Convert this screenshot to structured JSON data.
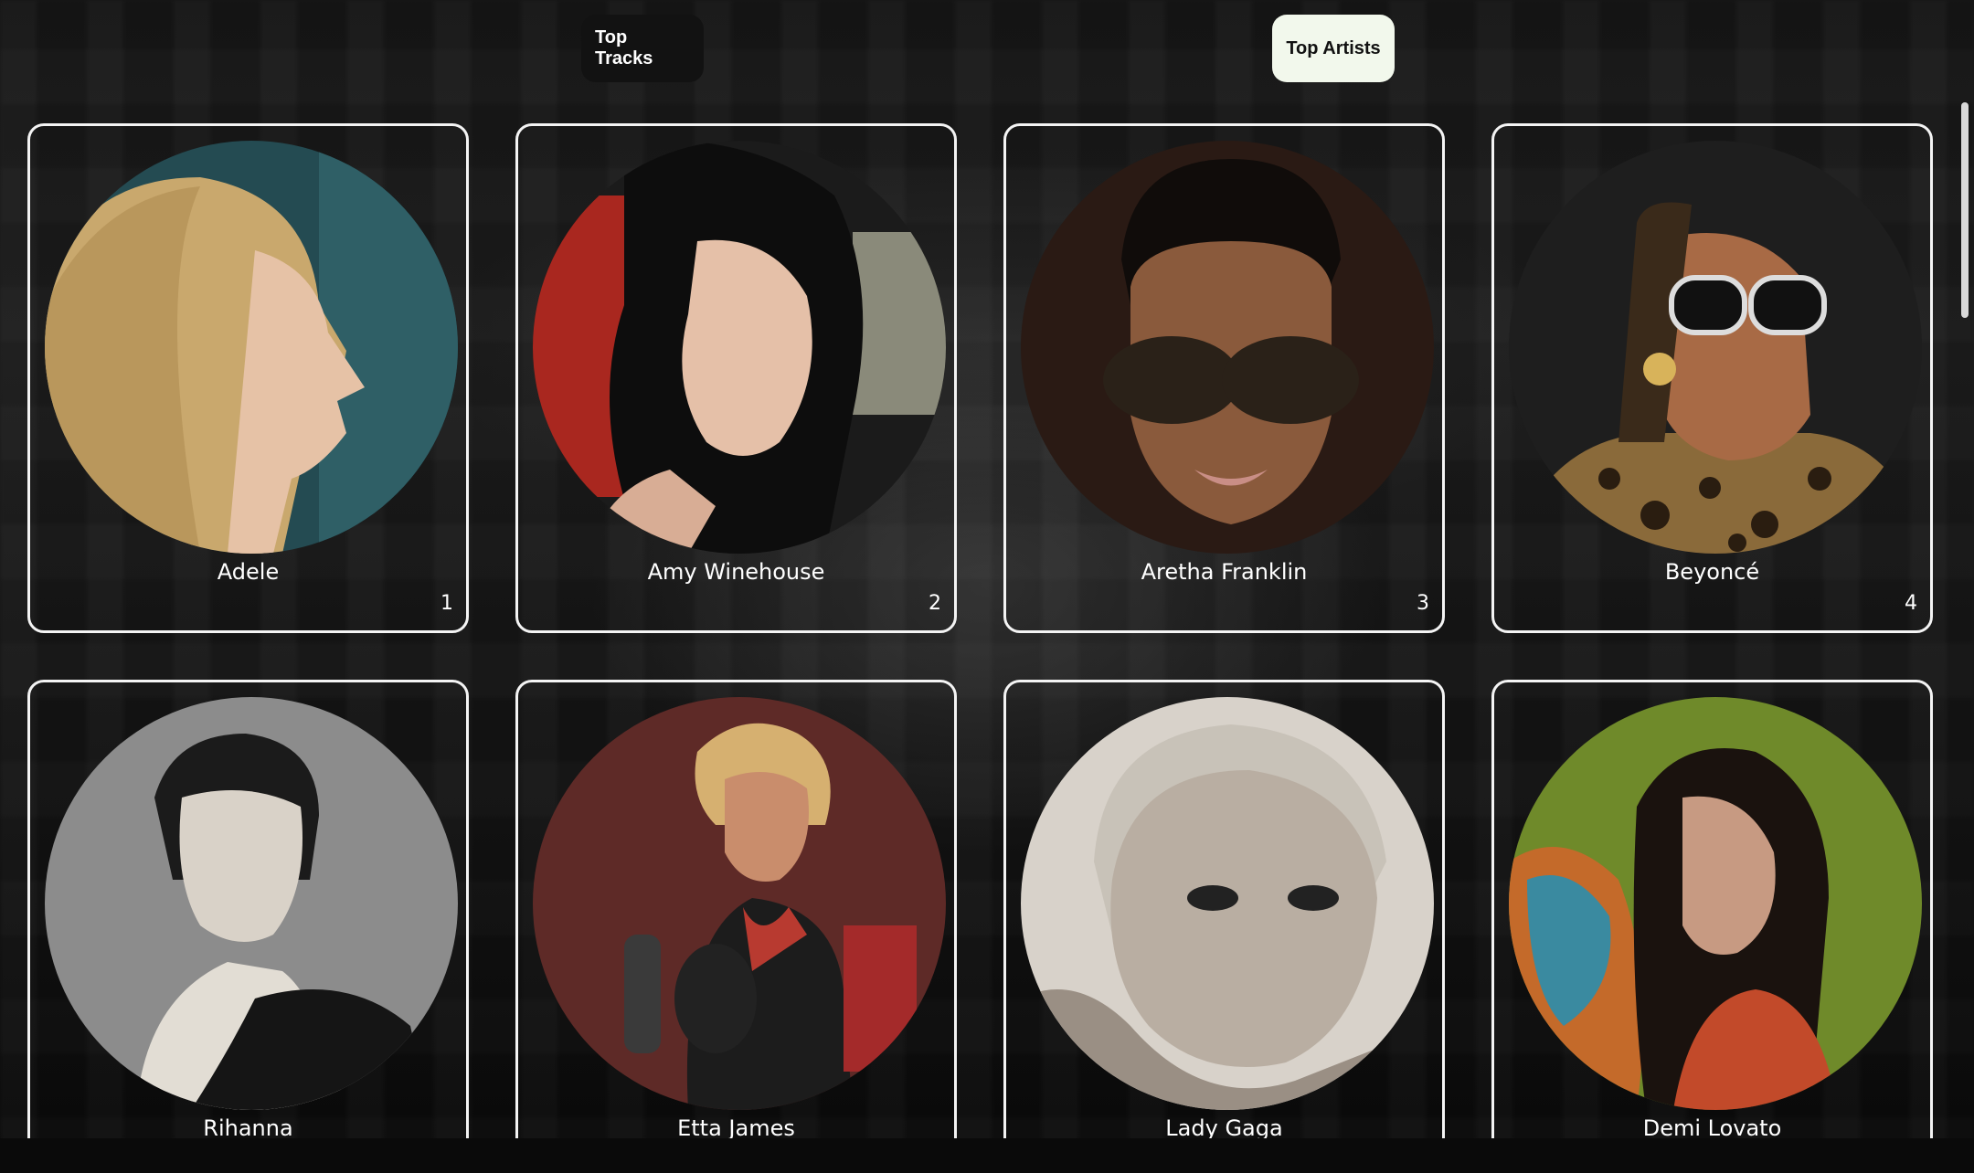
{
  "tabs": {
    "tracks_label": "Top Tracks",
    "artists_label": "Top Artists",
    "active": "Top Artists"
  },
  "artists": [
    {
      "name": "Adele",
      "rank": "1"
    },
    {
      "name": "Amy Winehouse",
      "rank": "2"
    },
    {
      "name": "Aretha Franklin",
      "rank": "3"
    },
    {
      "name": "Beyoncé",
      "rank": "4"
    },
    {
      "name": "Rihanna",
      "rank": ""
    },
    {
      "name": "Etta James",
      "rank": ""
    },
    {
      "name": "Lady Gaga",
      "rank": ""
    },
    {
      "name": "Demi Lovato",
      "rank": ""
    }
  ],
  "colors": {
    "active_tab_bg": "#f2f8ec",
    "inactive_tab_bg": "#121212",
    "card_border": "#f4f4f4"
  }
}
